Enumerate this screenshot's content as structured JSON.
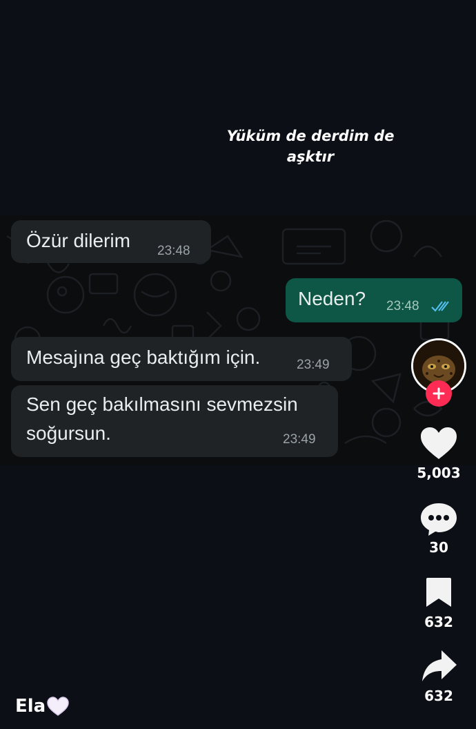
{
  "video": {
    "caption_line1": "Yüküm de derdim de",
    "caption_line2": "aşktır"
  },
  "chat": {
    "messages": [
      {
        "direction": "incoming",
        "text": "Özür dilerim",
        "time": "23:48"
      },
      {
        "direction": "outgoing",
        "text": "Neden?",
        "time": "23:48",
        "status": "read"
      },
      {
        "direction": "incoming",
        "text": "Mesajına geç baktığım için.",
        "time": "23:49"
      },
      {
        "direction": "incoming",
        "text_line1": "Sen geç bakılmasını sevmezsin",
        "text_line2": "soğursun.",
        "time": "23:49"
      }
    ],
    "colors": {
      "incoming": "#1f2326",
      "outgoing": "#0e5645",
      "read_tick": "#53bdeb"
    }
  },
  "actions": {
    "likes": "5,003",
    "comments": "30",
    "saves": "632",
    "shares": "632"
  },
  "author": {
    "username": "Ela",
    "emoji_icon": "white-heart-icon"
  },
  "colors": {
    "follow": "#fe2c55"
  }
}
